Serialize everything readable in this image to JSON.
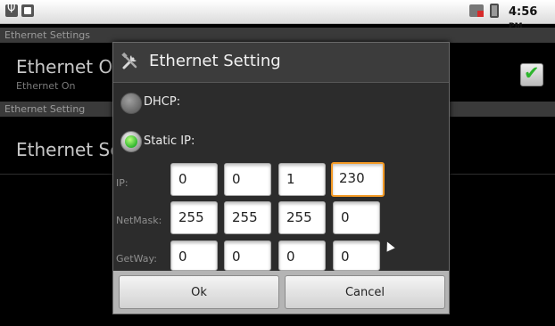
{
  "statusbar": {
    "time": "4:56",
    "ampm": "PM",
    "icons": [
      "usb-icon",
      "notification-icon",
      "network-icon",
      "battery-icon"
    ]
  },
  "background": {
    "section1_header": "Ethernet Settings",
    "ethernet_on_title": "Ethernet On",
    "ethernet_on_sub": "Ethernet On",
    "ethernet_on_checked": true,
    "section2_header": "Ethernet Setting",
    "ethernet_setting_title": "Ethernet Setting"
  },
  "dialog": {
    "title": "Ethernet Setting",
    "dhcp_label": "DHCP:",
    "static_label": "Static IP:",
    "selected_mode": "Static IP",
    "ip": {
      "label": "IP:",
      "octets": [
        "0",
        "0",
        "1",
        "230"
      ]
    },
    "netmask": {
      "label": "NetMask:",
      "octets": [
        "255",
        "255",
        "255",
        "0"
      ]
    },
    "gateway": {
      "label": "GetWay:",
      "octets": [
        "0",
        "0",
        "0",
        "0"
      ]
    },
    "ok_label": "Ok",
    "cancel_label": "Cancel"
  },
  "colors": {
    "accent_focus": "#f39a26",
    "radio_selected": "#2fb52f",
    "checkbox_check": "#2db52d"
  }
}
